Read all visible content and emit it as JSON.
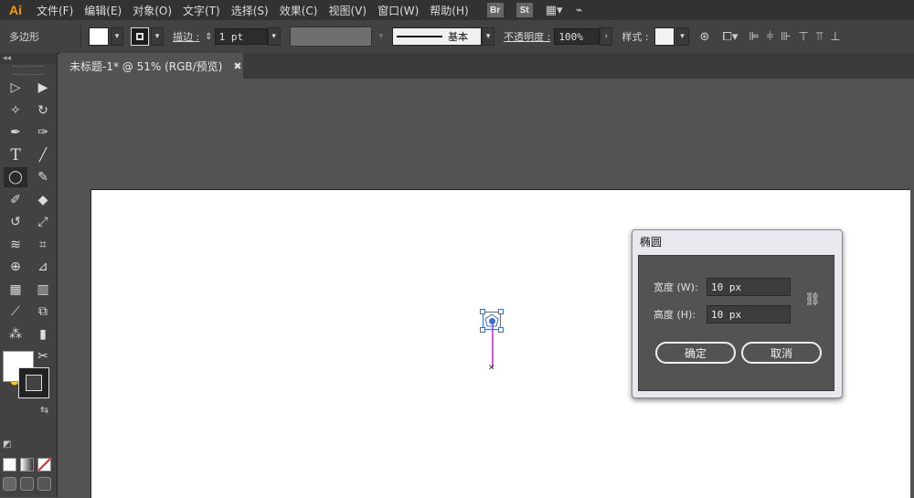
{
  "app": {
    "logo": "Ai"
  },
  "menu": [
    "文件(F)",
    "编辑(E)",
    "对象(O)",
    "文字(T)",
    "选择(S)",
    "效果(C)",
    "视图(V)",
    "窗口(W)",
    "帮助(H)"
  ],
  "menubar_badges": [
    "Br",
    "St"
  ],
  "control": {
    "object_type": "多边形",
    "stroke_label": "描边 :",
    "stroke_weight": "1 pt",
    "stroke_style": "基本",
    "opacity_label": "不透明度 :",
    "opacity_value": "100%",
    "style_label": "样式 :"
  },
  "tab": {
    "title": "未标题-1* @ 51% (RGB/预览)",
    "close": "✖"
  },
  "tools_header": "◂◂",
  "tools": [
    [
      "selection-arrow-icon",
      "direct-selection-icon"
    ],
    [
      "magic-wand-icon",
      "lasso-icon"
    ],
    [
      "pen-icon",
      "curvature-icon"
    ],
    [
      "type-icon",
      "line-segment-icon"
    ],
    [
      "ellipse-icon",
      "paintbrush-icon"
    ],
    [
      "shaper-icon",
      "eraser-icon"
    ],
    [
      "rotate-icon",
      "scale-icon"
    ],
    [
      "width-icon",
      "free-transform-icon"
    ],
    [
      "shape-builder-icon",
      "perspective-grid-icon"
    ],
    [
      "mesh-icon",
      "gradient-icon"
    ],
    [
      "eyedropper-icon",
      "blend-icon"
    ],
    [
      "symbol-sprayer-icon",
      "column-graph-icon"
    ],
    [
      "artboard-icon",
      "slice-icon"
    ],
    [
      "hand-icon",
      "zoom-icon"
    ]
  ],
  "dialog": {
    "title": "椭圆",
    "width_label": "宽度 (W):",
    "width_value": "10 px",
    "height_label": "高度 (H):",
    "height_value": "10 px",
    "ok": "确定",
    "cancel": "取消"
  }
}
